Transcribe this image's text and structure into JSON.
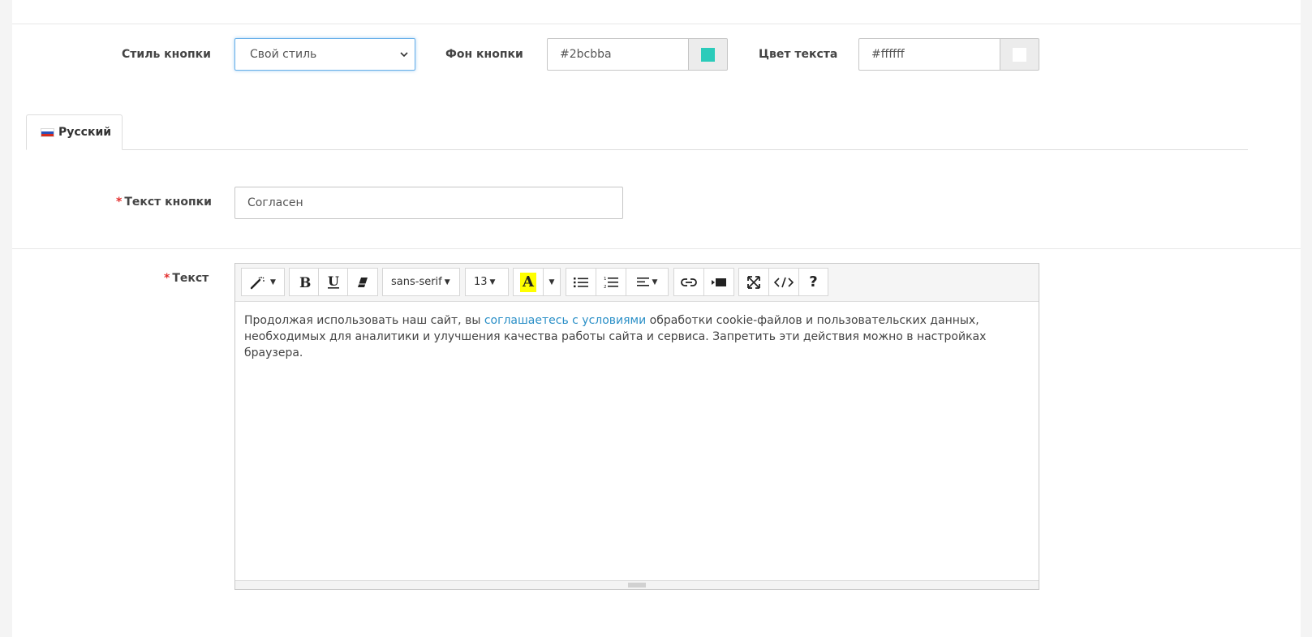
{
  "form": {
    "button_style": {
      "label": "Стиль кнопки",
      "value": "Свой стиль"
    },
    "button_bg": {
      "label": "Фон кнопки",
      "value": "#2bcbba",
      "swatch": "#2bcbba"
    },
    "text_color": {
      "label": "Цвет текста",
      "value": "#ffffff",
      "swatch": "#ffffff"
    }
  },
  "tabs": [
    {
      "label": "Русский",
      "icon": "russia-flag-icon"
    }
  ],
  "button_text": {
    "label": "Текст кнопки",
    "required_mark": "*",
    "value": "Согласен"
  },
  "text": {
    "label": "Текст",
    "required_mark": "*",
    "content_before": "Продолжая использовать наш сайт, вы ",
    "content_link": "соглашаетесь с условиями",
    "content_after": " обработки cookie-файлов и пользовательских данных, необходимых для аналитики и улучшения качества работы сайта и сервиса. Запретить эти действия можно в настройках браузера."
  },
  "toolbar": {
    "font_family": "sans-serif",
    "font_size": "13",
    "highlight_letter": "A",
    "highlight_color": "#ffff00",
    "help_label": "?",
    "icons": [
      "magic-wand-icon",
      "bold-icon",
      "underline-icon",
      "eraser-icon",
      "text-color-icon",
      "unordered-list-icon",
      "ordered-list-icon",
      "align-icon",
      "link-icon",
      "video-icon",
      "fullscreen-icon",
      "code-view-icon",
      "help-icon"
    ]
  }
}
